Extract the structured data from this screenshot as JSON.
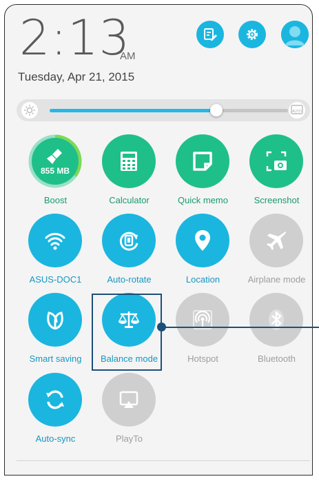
{
  "status": {
    "time": "2:13",
    "ampm": "AM",
    "date": "Tuesday, Apr 21, 2015"
  },
  "header_icons": [
    {
      "name": "edit-note-icon",
      "color": "#1ab6e0"
    },
    {
      "name": "gear-icon",
      "color": "#1ab6e0"
    },
    {
      "name": "user-avatar-icon",
      "color": "#1ab6e0"
    }
  ],
  "brightness": {
    "level": 0.7,
    "low_icon": "brightness-low-icon",
    "auto_icon": "brightness-auto-icon",
    "auto_label": "AUTO"
  },
  "boost": {
    "memory": "855 MB",
    "ring_fill": 0.35
  },
  "tiles": [
    {
      "label": "Boost",
      "state": "on-green",
      "icon": "broom-icon"
    },
    {
      "label": "Calculator",
      "state": "on-green",
      "icon": "calculator-icon"
    },
    {
      "label": "Quick memo",
      "state": "on-green",
      "icon": "memo-icon"
    },
    {
      "label": "Screenshot",
      "state": "on-green",
      "icon": "camera-crop-icon"
    },
    {
      "label": "ASUS-DOC1",
      "state": "on-blue",
      "icon": "wifi-icon"
    },
    {
      "label": "Auto-rotate",
      "state": "on-blue",
      "icon": "rotate-icon"
    },
    {
      "label": "Location",
      "state": "on-blue",
      "icon": "location-pin-icon"
    },
    {
      "label": "Airplane mode",
      "state": "off",
      "icon": "airplane-icon"
    },
    {
      "label": "Smart saving",
      "state": "on-blue",
      "icon": "leaf-icon"
    },
    {
      "label": "Balance mode",
      "state": "on-blue",
      "icon": "scales-icon"
    },
    {
      "label": "Hotspot",
      "state": "off",
      "icon": "hotspot-icon"
    },
    {
      "label": "Bluetooth",
      "state": "off",
      "icon": "bluetooth-icon"
    },
    {
      "label": "Auto-sync",
      "state": "on-blue",
      "icon": "sync-icon"
    },
    {
      "label": "PlayTo",
      "state": "off",
      "icon": "cast-icon"
    }
  ],
  "colors": {
    "green": "#1fbf8a",
    "blue": "#1ab6e0",
    "off": "#cfcfcf",
    "callout": "#1b4f7a"
  }
}
